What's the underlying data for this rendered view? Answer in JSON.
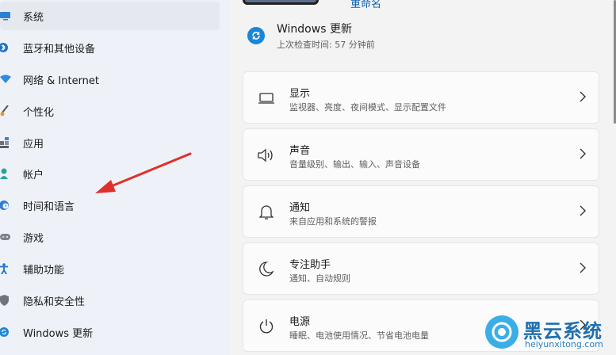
{
  "sidebar": {
    "items": [
      {
        "label": "系统",
        "icon": "monitor-icon",
        "active": true
      },
      {
        "label": "蓝牙和其他设备",
        "icon": "bluetooth-icon"
      },
      {
        "label": "网络 & Internet",
        "icon": "wifi-icon"
      },
      {
        "label": "个性化",
        "icon": "brush-icon"
      },
      {
        "label": "应用",
        "icon": "apps-icon"
      },
      {
        "label": "帐户",
        "icon": "person-icon"
      },
      {
        "label": "时间和语言",
        "icon": "clock-globe-icon"
      },
      {
        "label": "游戏",
        "icon": "gamepad-icon"
      },
      {
        "label": "辅助功能",
        "icon": "accessibility-icon"
      },
      {
        "label": "隐私和安全性",
        "icon": "shield-icon"
      },
      {
        "label": "Windows 更新",
        "icon": "update-icon"
      }
    ]
  },
  "header": {
    "rename_link": "重命名"
  },
  "update_status": {
    "title": "Windows 更新",
    "subtitle": "上次检查时间: 57 分钟前"
  },
  "cards": [
    {
      "title": "显示",
      "subtitle": "监视器、亮度、夜间模式、显示配置文件",
      "icon": "display-icon"
    },
    {
      "title": "声音",
      "subtitle": "音量级别、输出、输入、声音设备",
      "icon": "speaker-icon"
    },
    {
      "title": "通知",
      "subtitle": "来自应用和系统的警报",
      "icon": "bell-icon"
    },
    {
      "title": "专注助手",
      "subtitle": "通知、自动规则",
      "icon": "moon-icon"
    },
    {
      "title": "电源",
      "subtitle": "睡眠、电池使用情况、节省电池电量",
      "icon": "power-icon"
    }
  ],
  "watermark": {
    "name": "黑云系统",
    "url": "heiyunxitong.com"
  },
  "colors": {
    "accent": "#0a5fb5",
    "annotation_arrow": "#e0302b",
    "sidebar_bg": "#eef2f8",
    "card_bg": "#fbfbfb"
  }
}
